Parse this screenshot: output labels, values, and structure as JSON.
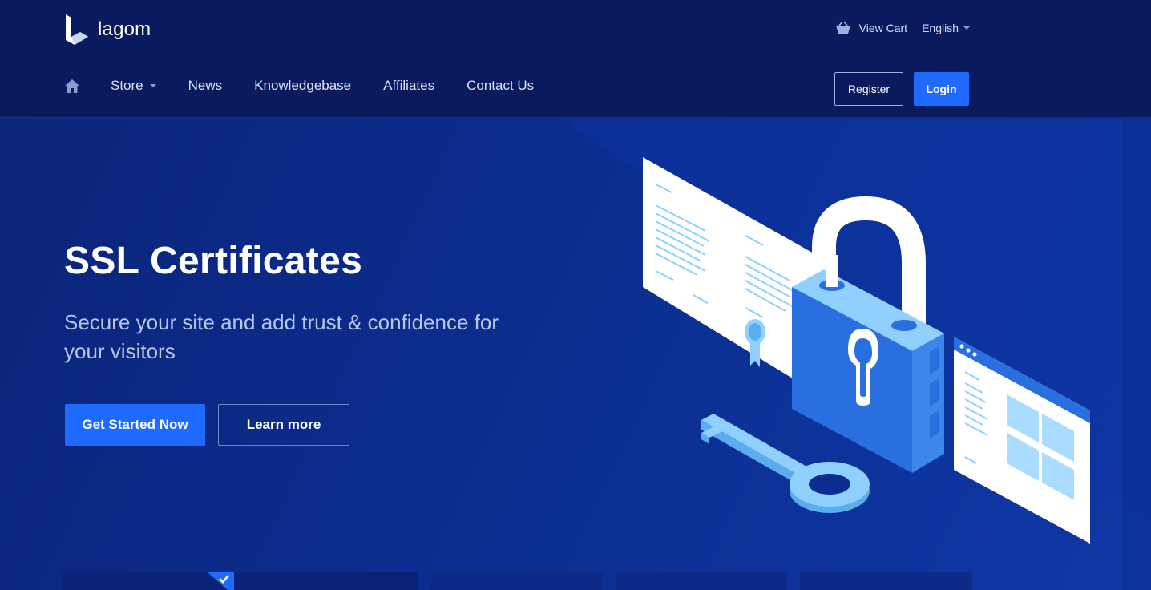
{
  "brand": {
    "name": "lagom"
  },
  "topbar": {
    "view_cart": "View Cart",
    "language": "English"
  },
  "nav": {
    "items": [
      {
        "label": "Store",
        "has_dropdown": true
      },
      {
        "label": "News"
      },
      {
        "label": "Knowledgebase"
      },
      {
        "label": "Affiliates"
      },
      {
        "label": "Contact Us"
      }
    ],
    "register": "Register",
    "login": "Login"
  },
  "hero": {
    "title": "SSL Certificates",
    "subtitle": "Secure your site and add trust & confidence for your visitors",
    "primary_button": "Get Started Now",
    "secondary_button": "Learn more"
  },
  "colors": {
    "header_bg": "#0a1a5e",
    "hero_bg": "#0c2d8f",
    "accent": "#1f6bff",
    "lock_body": "#2a6fe0",
    "lock_light": "#8fd0ff"
  },
  "icons": [
    "lagom-logo-icon",
    "basket-icon",
    "home-icon",
    "chevron-down-icon",
    "checkmark-icon"
  ]
}
